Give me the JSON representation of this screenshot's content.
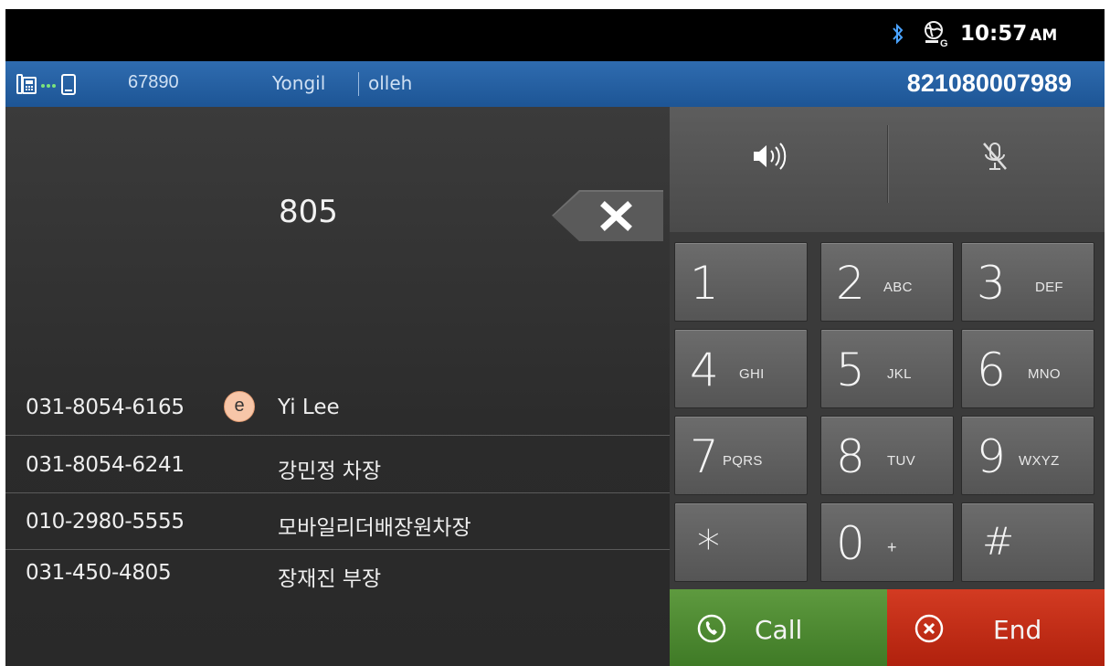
{
  "status_bar": {
    "time": "10:57",
    "ampm": "AM",
    "icons": [
      "bluetooth-icon",
      "network-globe-icon"
    ]
  },
  "info_bar": {
    "extension": "67890",
    "user": "Yongil",
    "carrier": "olleh",
    "phone_number": "821080007989",
    "icons": [
      "desk-phone-icon",
      "link-dots-icon",
      "mobile-phone-icon"
    ]
  },
  "dialer": {
    "entered_number": "805"
  },
  "results": [
    {
      "number": "031-8054-6165",
      "badge": "e",
      "name": "Yi Lee"
    },
    {
      "number": "031-8054-6241",
      "badge": "",
      "name": "강민정 차장"
    },
    {
      "number": "010-2980-5555",
      "badge": "",
      "name": "모바일리더배장원차장"
    },
    {
      "number": "031-450-4805",
      "badge": "",
      "name": "장재진 부장"
    }
  ],
  "keypad": [
    {
      "digit": "1",
      "letters": ""
    },
    {
      "digit": "2",
      "letters": "ABC"
    },
    {
      "digit": "3",
      "letters": "DEF"
    },
    {
      "digit": "4",
      "letters": "GHI"
    },
    {
      "digit": "5",
      "letters": "JKL"
    },
    {
      "digit": "6",
      "letters": "MNO"
    },
    {
      "digit": "7",
      "letters": "PQRS"
    },
    {
      "digit": "8",
      "letters": "TUV"
    },
    {
      "digit": "9",
      "letters": "WXYZ"
    },
    {
      "digit": "*",
      "letters": ""
    },
    {
      "digit": "0",
      "letters": "+"
    },
    {
      "digit": "#",
      "letters": ""
    }
  ],
  "actions": {
    "call_label": "Call",
    "end_label": "End"
  },
  "colors": {
    "info_bar": "#2560a3",
    "call": "#4a8a2e",
    "end": "#c02c14",
    "badge": "#f7c6a8"
  }
}
